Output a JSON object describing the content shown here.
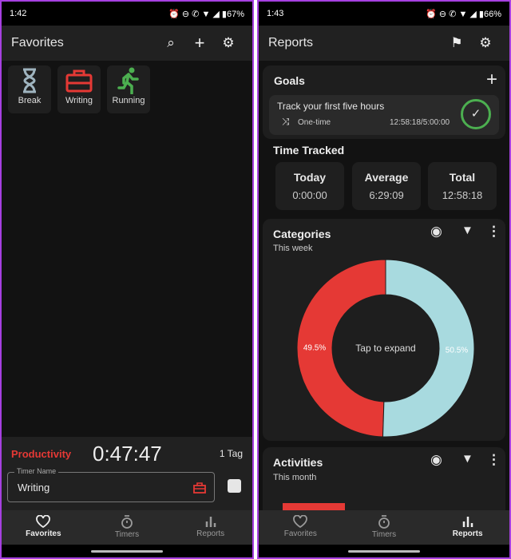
{
  "left": {
    "status": {
      "time": "1:42",
      "battery": "67%"
    },
    "appbar": {
      "title": "Favorites",
      "icons": [
        "search-icon",
        "plus-icon",
        "gear-icon"
      ]
    },
    "favorites": [
      {
        "label": "Break",
        "icon": "hourglass-icon",
        "color": "#9fb4bf"
      },
      {
        "label": "Writing",
        "icon": "briefcase-icon",
        "color": "#e53935"
      },
      {
        "label": "Running",
        "icon": "running-icon",
        "color": "#4caf50"
      }
    ],
    "timer": {
      "category": "Productivity",
      "category_color": "#e53935",
      "elapsed": "0:47:47",
      "tags": "1 Tag",
      "name_label": "Timer Name",
      "name_value": "Writing"
    },
    "nav": [
      {
        "label": "Favorites",
        "active": true
      },
      {
        "label": "Timers"
      },
      {
        "label": "Reports"
      }
    ]
  },
  "right": {
    "status": {
      "time": "1:43",
      "battery": "66%"
    },
    "appbar": {
      "title": "Reports",
      "icons": [
        "flag-icon",
        "gear-icon"
      ]
    },
    "goals": {
      "title": "Goals",
      "item": {
        "title": "Track your first five hours",
        "type": "One-time",
        "progress": "12:58:18/5:00:00",
        "complete": true
      }
    },
    "time_tracked": {
      "title": "Time Tracked",
      "stats": [
        {
          "label": "Today",
          "value": "0:00:00"
        },
        {
          "label": "Average",
          "value": "6:29:09"
        },
        {
          "label": "Total",
          "value": "12:58:18"
        }
      ]
    },
    "categories": {
      "title": "Categories",
      "period": "This week",
      "center": "Tap to expand",
      "slices": [
        {
          "label": "49.5%",
          "value": 49.5,
          "color": "#e53935"
        },
        {
          "label": "50.5%",
          "value": 50.5,
          "color": "#a8dadf"
        }
      ]
    },
    "activities": {
      "title": "Activities",
      "period": "This month",
      "bar_color": "#e53935"
    },
    "nav": [
      {
        "label": "Favorites"
      },
      {
        "label": "Timers"
      },
      {
        "label": "Reports",
        "active": true
      }
    ]
  }
}
